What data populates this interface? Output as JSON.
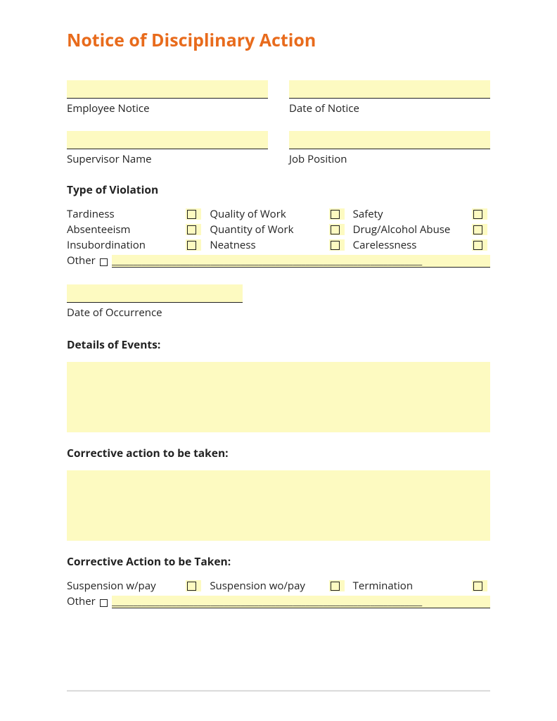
{
  "title": "Notice of Disciplinary Action",
  "fields": {
    "employee_notice": "Employee Notice",
    "date_of_notice": "Date of Notice",
    "supervisor_name": "Supervisor Name",
    "job_position": "Job Position",
    "date_of_occurrence": "Date of Occurrence"
  },
  "sections": {
    "type_of_violation": "Type of Violation",
    "details_of_events": "Details of Events:",
    "corrective_action_lower": "Corrective action to be taken:",
    "corrective_action_upper": "Corrective Action to be Taken:"
  },
  "violations": [
    "Tardiness",
    "Quality of Work",
    "Safety",
    "Absenteeism",
    "Quantity of Work",
    "Drug/Alcohol Abuse",
    "Insubordination",
    "Neatness",
    "Carelessness"
  ],
  "other_label": "Other",
  "corrective_actions": [
    "Suspension w/pay",
    "Suspension wo/pay",
    "Termination"
  ]
}
